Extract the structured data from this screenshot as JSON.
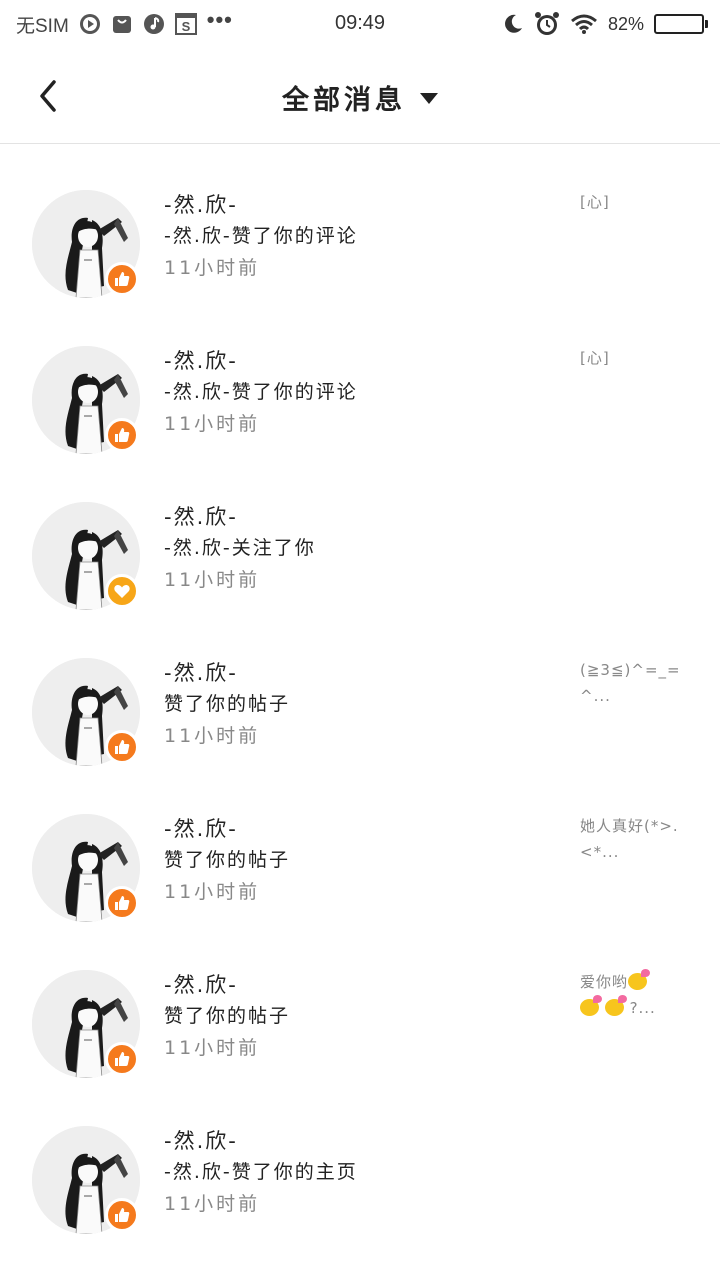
{
  "status_bar": {
    "carrier": "无SIM",
    "icons_left": [
      "play-icon",
      "bag-icon",
      "music-icon",
      "s-icon"
    ],
    "more": "•••",
    "time": "09:49",
    "icons_right": [
      "moon-icon",
      "alarm-icon",
      "wifi-icon"
    ],
    "battery_text": "82%",
    "battery_level": 0.82
  },
  "header": {
    "back_icon": "chevron-left-icon",
    "title": "全部消息",
    "dropdown_icon": "caret-down-icon"
  },
  "messages": [
    {
      "name": "-然.欣-",
      "action": "-然.欣-赞了你的评论",
      "time": "11小时前",
      "badge": "like",
      "preview": "[心]"
    },
    {
      "name": "-然.欣-",
      "action": "-然.欣-赞了你的评论",
      "time": "11小时前",
      "badge": "like",
      "preview": "[心]"
    },
    {
      "name": "-然.欣-",
      "action": "-然.欣-关注了你",
      "time": "11小时前",
      "badge": "heart",
      "preview": ""
    },
    {
      "name": "-然.欣-",
      "action": "赞了你的帖子",
      "time": "11小时前",
      "badge": "like",
      "preview": "(≧3≦)^=_=^..."
    },
    {
      "name": "-然.欣-",
      "action": "赞了你的帖子",
      "time": "11小时前",
      "badge": "like",
      "preview": "她人真好(*>.<*..."
    },
    {
      "name": "-然.欣-",
      "action": "赞了你的帖子",
      "time": "11小时前",
      "badge": "like",
      "preview": "爱你哟",
      "preview_tail": "?..."
    },
    {
      "name": "-然.欣-",
      "action": "-然.欣-赞了你的主页",
      "time": "11小时前",
      "badge": "like",
      "preview": ""
    }
  ],
  "colors": {
    "like_badge": "#f57a1d",
    "heart_badge": "#f7a618",
    "divider": "#e3e3e3"
  }
}
